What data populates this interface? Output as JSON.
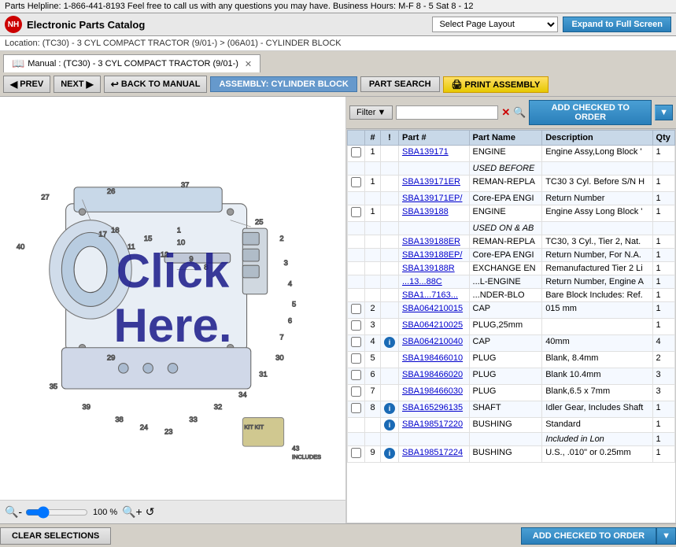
{
  "topbar": {
    "text": "Parts Helpline: 1-866-441-8193 Feel free to call us with any questions you may have. Business Hours: M-F 8 - 5 Sat 8 - 12"
  },
  "header": {
    "logo": "NH",
    "title": "Electronic Parts Catalog",
    "page_layout_placeholder": "Select Page Layout",
    "expand_label": "Expand to Full Screen"
  },
  "location": {
    "text": "Location: (TC30) - 3 CYL COMPACT TRACTOR (9/01-) > (06A01) - CYLINDER BLOCK"
  },
  "tab": {
    "label": "Manual : (TC30) - 3 CYL COMPACT TRACTOR (9/01-)"
  },
  "toolbar": {
    "prev_label": "PREV",
    "next_label": "NEXT",
    "back_label": "BACK TO MANUAL",
    "assembly_label": "ASSEMBLY: CYLINDER BLOCK",
    "part_search_label": "PART SEARCH",
    "print_label": "PRINT ASSEMBLY"
  },
  "filter": {
    "label": "Filter",
    "placeholder": "",
    "add_to_order_label": "ADD CHECKED TO ORDER"
  },
  "table": {
    "headers": [
      "",
      "#",
      "!",
      "Part #",
      "Part Name",
      "Description",
      "Qty"
    ],
    "rows": [
      {
        "cb": true,
        "num": "1",
        "info": false,
        "part": "SBA139171",
        "name": "ENGINE",
        "desc": "Engine Assy,Long Block '",
        "qty": "1"
      },
      {
        "cb": false,
        "num": "",
        "info": false,
        "part": "",
        "name": "USED BEFORE",
        "desc": "",
        "qty": "",
        "italic": true
      },
      {
        "cb": true,
        "num": "1",
        "info": false,
        "part": "SBA139171ER",
        "name": "REMAN-REPLA",
        "desc": "TC30 3 Cyl. Before S/N H",
        "qty": "1"
      },
      {
        "cb": false,
        "num": "",
        "info": false,
        "part": "SBA139171EP/",
        "name": "Core-EPA ENGI",
        "desc": "Return Number",
        "qty": "1"
      },
      {
        "cb": true,
        "num": "1",
        "info": false,
        "part": "SBA139188",
        "name": "ENGINE",
        "desc": "Engine Assy Long Block '",
        "qty": "1"
      },
      {
        "cb": false,
        "num": "",
        "info": false,
        "part": "",
        "name": "USED ON & AB",
        "desc": "",
        "qty": "",
        "italic": true
      },
      {
        "cb": false,
        "num": "",
        "info": false,
        "part": "SBA139188ER",
        "name": "REMAN-REPLA",
        "desc": "TC30, 3 Cyl., Tier 2, Nat.",
        "qty": "1"
      },
      {
        "cb": false,
        "num": "",
        "info": false,
        "part": "SBA139188EP/",
        "name": "Core-EPA ENGI",
        "desc": "Return Number, For N.A.",
        "qty": "1"
      },
      {
        "cb": false,
        "num": "",
        "info": false,
        "part": "SBA139188R",
        "name": "EXCHANGE EN",
        "desc": "Remanufactured Tier 2 Li",
        "qty": "1"
      },
      {
        "cb": false,
        "num": "",
        "info": false,
        "part": "...13...88C",
        "name": "...L-ENGINE",
        "desc": "Return Number, Engine A",
        "qty": "1"
      },
      {
        "cb": false,
        "num": "",
        "info": false,
        "part": "SBA1...7163...",
        "name": "...NDER-BLO",
        "desc": "Bare Block Includes: Ref.",
        "qty": "1"
      },
      {
        "cb": true,
        "num": "2",
        "info": false,
        "part": "SBA064210015",
        "name": "CAP",
        "desc": "015 mm",
        "qty": "1"
      },
      {
        "cb": true,
        "num": "3",
        "info": false,
        "part": "SBA064210025",
        "name": "PLUG,25mm",
        "desc": "",
        "qty": "1"
      },
      {
        "cb": true,
        "num": "4",
        "info": true,
        "part": "SBA064210040",
        "name": "CAP",
        "desc": "40mm",
        "qty": "4"
      },
      {
        "cb": true,
        "num": "5",
        "info": false,
        "part": "SBA198466010",
        "name": "PLUG",
        "desc": "Blank, 8.4mm",
        "qty": "2"
      },
      {
        "cb": true,
        "num": "6",
        "info": false,
        "part": "SBA198466020",
        "name": "PLUG",
        "desc": "Blank 10.4mm",
        "qty": "3"
      },
      {
        "cb": true,
        "num": "7",
        "info": false,
        "part": "SBA198466030",
        "name": "PLUG",
        "desc": "Blank,6.5 x 7mm",
        "qty": "3"
      },
      {
        "cb": true,
        "num": "8",
        "info": true,
        "part": "SBA165296135",
        "name": "SHAFT",
        "desc": "Idler Gear, Includes Shaft",
        "qty": "1"
      },
      {
        "cb": true,
        "num": "",
        "info": true,
        "part": "SBA198517220",
        "name": "BUSHING",
        "desc": "Standard",
        "qty": "1"
      },
      {
        "cb": false,
        "num": "",
        "info": false,
        "part": "",
        "name": "",
        "desc": "Included in Lon",
        "qty": "1",
        "included": true
      },
      {
        "cb": true,
        "num": "9",
        "info": true,
        "part": "SBA198517224",
        "name": "BUSHING",
        "desc": "U.S., .010\" or 0.25mm",
        "qty": "1"
      }
    ]
  },
  "zoom": {
    "level": "100 %"
  },
  "bottom": {
    "clear_label": "CLEAR SELECTIONS",
    "add_order_label": "ADD CHECKED TO ORDER"
  },
  "diagram": {
    "click_here_text": "Click Here."
  }
}
